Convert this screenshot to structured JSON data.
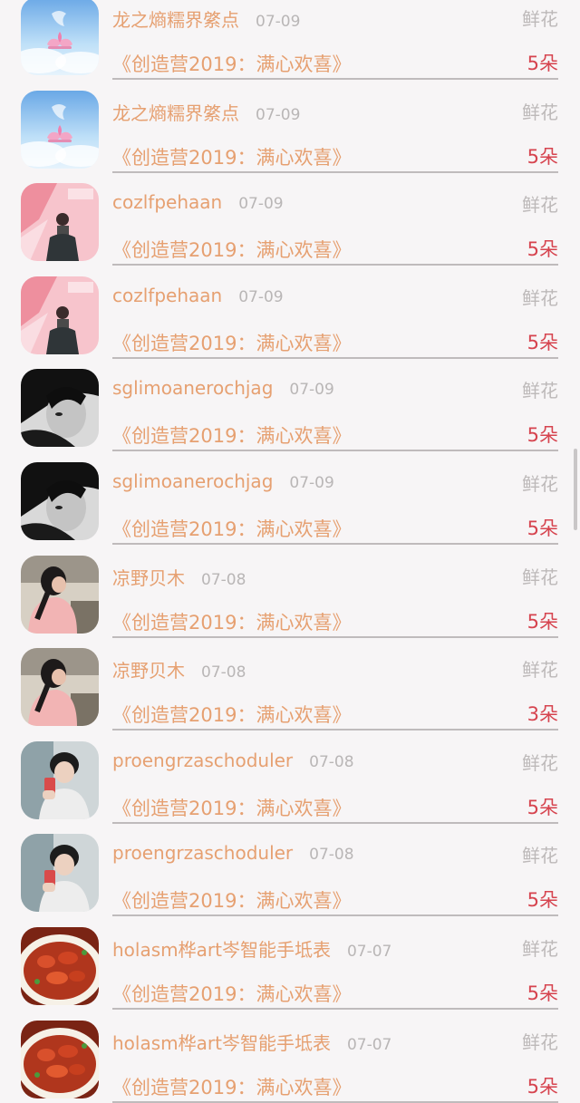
{
  "gift_list": [
    {
      "user": "龙之熵糯界綮点",
      "date": "07-09",
      "gift_type": "鲜花",
      "title": "《创造营2019：满心欢喜》",
      "count": "5朵",
      "avatar": "lotus-sky"
    },
    {
      "user": "龙之熵糯界綮点",
      "date": "07-09",
      "gift_type": "鲜花",
      "title": "《创造营2019：满心欢喜》",
      "count": "5朵",
      "avatar": "lotus-sky"
    },
    {
      "user": "cozlfpehaan",
      "date": "07-09",
      "gift_type": "鲜花",
      "title": "《创造营2019：满心欢喜》",
      "count": "5朵",
      "avatar": "pink-man"
    },
    {
      "user": "cozlfpehaan",
      "date": "07-09",
      "gift_type": "鲜花",
      "title": "《创造营2019：满心欢喜》",
      "count": "5朵",
      "avatar": "pink-man"
    },
    {
      "user": "sglimoanerochjag",
      "date": "07-09",
      "gift_type": "鲜花",
      "title": "《创造营2019：满心欢喜》",
      "count": "5朵",
      "avatar": "bw-portrait"
    },
    {
      "user": "sglimoanerochjag",
      "date": "07-09",
      "gift_type": "鲜花",
      "title": "《创造营2019：满心欢喜》",
      "count": "5朵",
      "avatar": "bw-portrait"
    },
    {
      "user": "凉野贝木",
      "date": "07-08",
      "gift_type": "鲜花",
      "title": "《创造营2019：满心欢喜》",
      "count": "5朵",
      "avatar": "girl-pink"
    },
    {
      "user": "凉野贝木",
      "date": "07-08",
      "gift_type": "鲜花",
      "title": "《创造营2019：满心欢喜》",
      "count": "3朵",
      "avatar": "girl-pink"
    },
    {
      "user": "proengrzaschoduler",
      "date": "07-08",
      "gift_type": "鲜花",
      "title": "《创造营2019：满心欢喜》",
      "count": "5朵",
      "avatar": "boy-phone"
    },
    {
      "user": "proengrzaschoduler",
      "date": "07-08",
      "gift_type": "鲜花",
      "title": "《创造营2019：满心欢喜》",
      "count": "5朵",
      "avatar": "boy-phone"
    },
    {
      "user": "holasm桦art岑智能手坻表",
      "date": "07-07",
      "gift_type": "鲜花",
      "title": "《创造营2019：满心欢喜》",
      "count": "5朵",
      "avatar": "food-plate"
    },
    {
      "user": "holasm桦art岑智能手坻表",
      "date": "07-07",
      "gift_type": "鲜花",
      "title": "《创造营2019：满心欢喜》",
      "count": "5朵",
      "avatar": "food-plate"
    }
  ]
}
